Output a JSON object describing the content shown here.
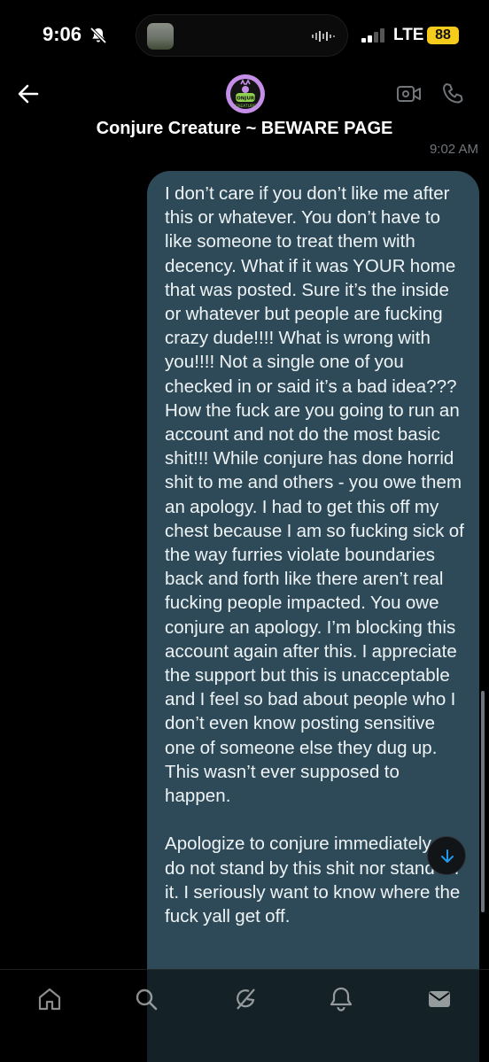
{
  "status_bar": {
    "time": "9:06",
    "network": "LTE",
    "battery": "88",
    "battery_color": "#f5cc1c"
  },
  "header": {
    "title": "Conjure Creature ~ BEWARE PAGE",
    "avatar_text": "CONJURE CREATURE",
    "avatar_color": "#c58ee8"
  },
  "conversation": {
    "timestamp": "9:02 AM",
    "message": "I don’t care if you don’t like me after this or whatever. You don’t have to like someone to treat them with decency. What if it was YOUR home that was posted. Sure it’s the inside or whatever but people are fucking crazy dude!!!! What is wrong with you!!!! Not a single one of you checked in or said it’s a bad idea??? How the fuck are you going to run an account and not do the most basic shit!!! While conjure has done horrid shit to me and others - you owe them an apology. I had to get this off my chest because I am so fucking sick of the way furries violate boundaries back and forth like there aren’t real fucking people impacted. You owe conjure an apology. I’m blocking this account again after this. I appreciate the support but this is unacceptable and I feel so bad about people who I don’t even know posting sensitive one of someone else they dug up. This wasn’t ever supposed to happen.\n\nApologize to conjure immediately. I do not stand by this shit nor stand for it. I seriously want to know where the fuck yall get off.",
    "bubble_color": "#2e4a58"
  },
  "icons": {
    "back": "back-arrow-icon",
    "video": "video-call-icon",
    "phone": "phone-icon",
    "jump": "arrow-down-icon"
  },
  "bottom_nav": [
    "home-icon",
    "search-icon",
    "grok-icon",
    "notifications-icon",
    "messages-icon"
  ]
}
